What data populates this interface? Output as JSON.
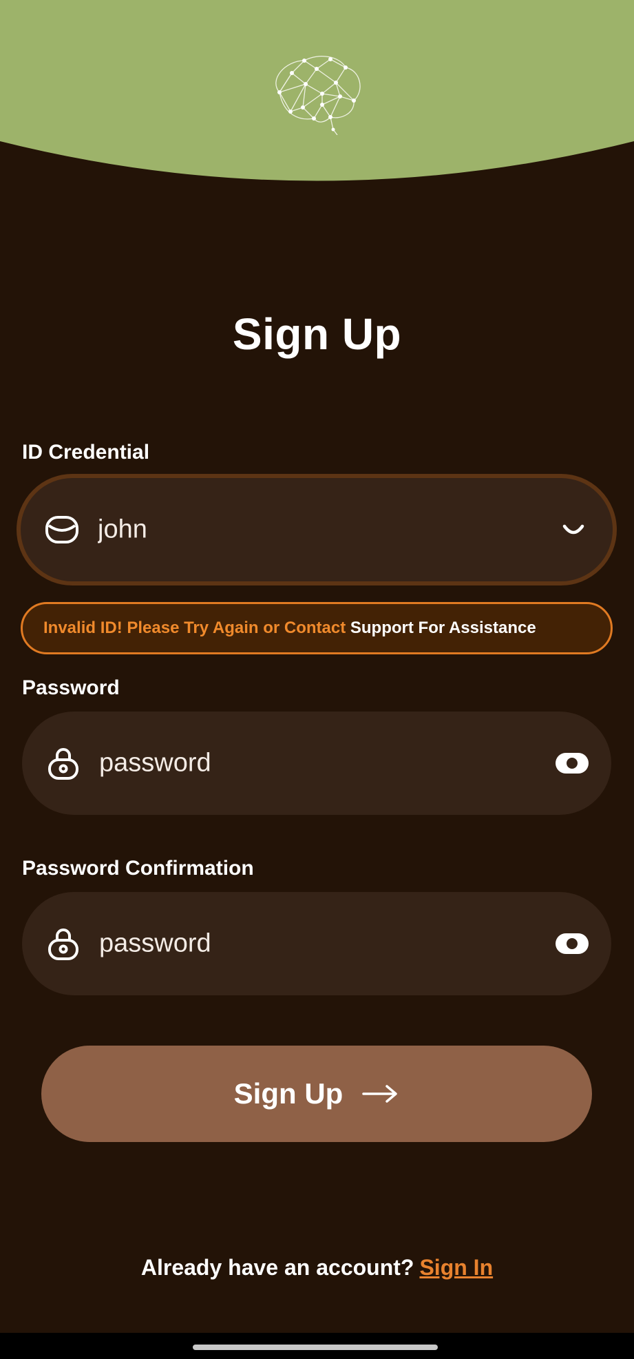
{
  "app": {
    "title": "Sign Up",
    "logo_icon": "brain-network-icon",
    "colors": {
      "header": "#9db36a",
      "background": "#231307",
      "field": "#352317",
      "accent": "#e8822e",
      "button": "#8f6147"
    }
  },
  "form": {
    "id_credential": {
      "label": "ID Credential",
      "value": "john",
      "icon": "id-card-icon",
      "trailing_icon": "chevron-down-icon"
    },
    "error": {
      "text_highlight": "Invalid ID! Please Try Again or Contact",
      "text_rest": " Support For Assistance"
    },
    "password": {
      "label": "Password",
      "value": "password",
      "icon": "lock-icon",
      "trailing_icon": "eye-icon"
    },
    "password_confirmation": {
      "label": "Password Confirmation",
      "value": "password",
      "icon": "lock-icon",
      "trailing_icon": "eye-icon"
    },
    "submit_label": "Sign Up",
    "submit_icon": "arrow-right-icon"
  },
  "footer": {
    "prompt": "Already have an account?",
    "link": "Sign In"
  }
}
